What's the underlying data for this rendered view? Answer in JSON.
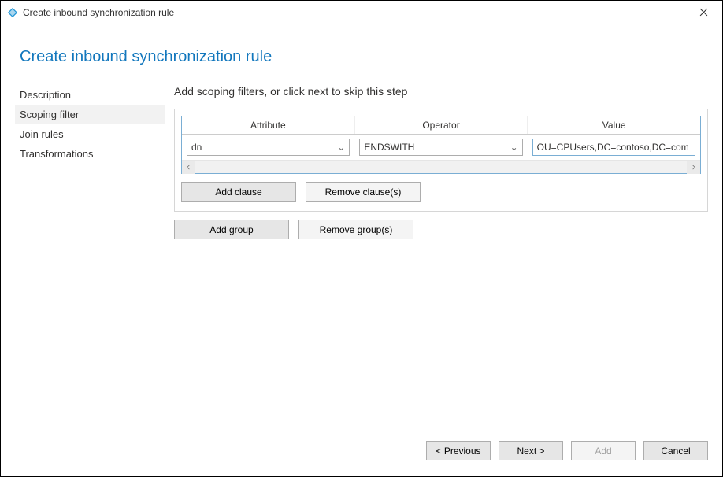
{
  "window": {
    "title": "Create inbound synchronization rule"
  },
  "heading": "Create inbound synchronization rule",
  "nav": {
    "items": [
      {
        "label": "Description",
        "selected": false
      },
      {
        "label": "Scoping filter",
        "selected": true
      },
      {
        "label": "Join rules",
        "selected": false
      },
      {
        "label": "Transformations",
        "selected": false
      }
    ]
  },
  "main": {
    "step_label": "Add scoping filters, or click next to skip this step",
    "columns": {
      "attribute": "Attribute",
      "operator": "Operator",
      "value": "Value"
    },
    "row": {
      "attribute": "dn",
      "operator": "ENDSWITH",
      "value": "OU=CPUsers,DC=contoso,DC=com"
    },
    "buttons": {
      "add_clause": "Add clause",
      "remove_clause": "Remove clause(s)",
      "add_group": "Add group",
      "remove_group": "Remove group(s)"
    }
  },
  "footer": {
    "previous": "< Previous",
    "next": "Next >",
    "add": "Add",
    "cancel": "Cancel"
  }
}
